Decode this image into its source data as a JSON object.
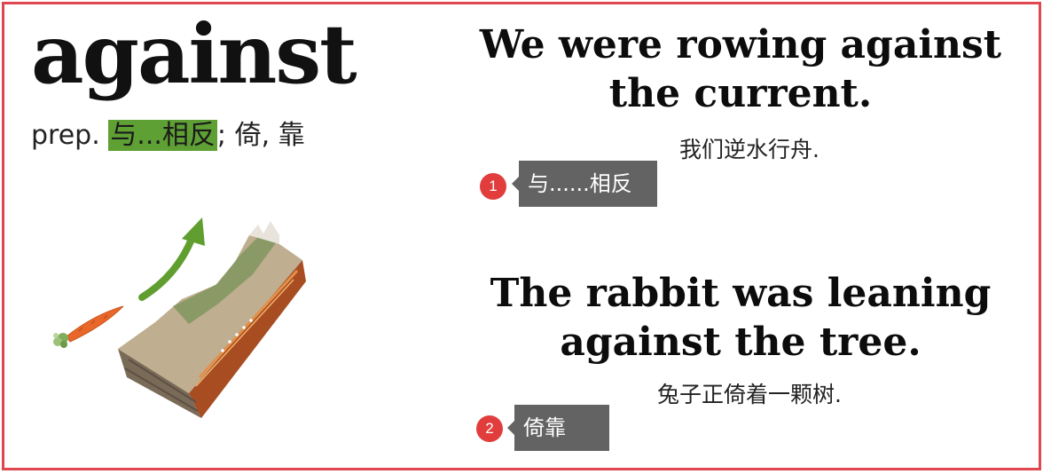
{
  "word": "against",
  "definition": {
    "pos": "prep.",
    "highlight": "与...相反",
    "rest": "; 倚, 靠"
  },
  "examples": [
    {
      "sentence": "We were rowing against the current.",
      "translation": "我们逆水行舟.",
      "note_number": "1",
      "note_text": "与......相反"
    },
    {
      "sentence": "The rabbit was leaning against the tree.",
      "translation": "兔子正倚着一颗树.",
      "note_number": "2",
      "note_text": "倚靠"
    }
  ],
  "colors": {
    "frame_border": "#e0474f",
    "highlight": "#5fa034",
    "badge": "#e13d3d",
    "note_bg": "#636363",
    "arrow": "#5f9e2f",
    "carrot": "#e9672a"
  },
  "illustration": {
    "icons": [
      "carrot-icon",
      "curved-arrow-icon",
      "mountain-terrain-illustration"
    ]
  }
}
